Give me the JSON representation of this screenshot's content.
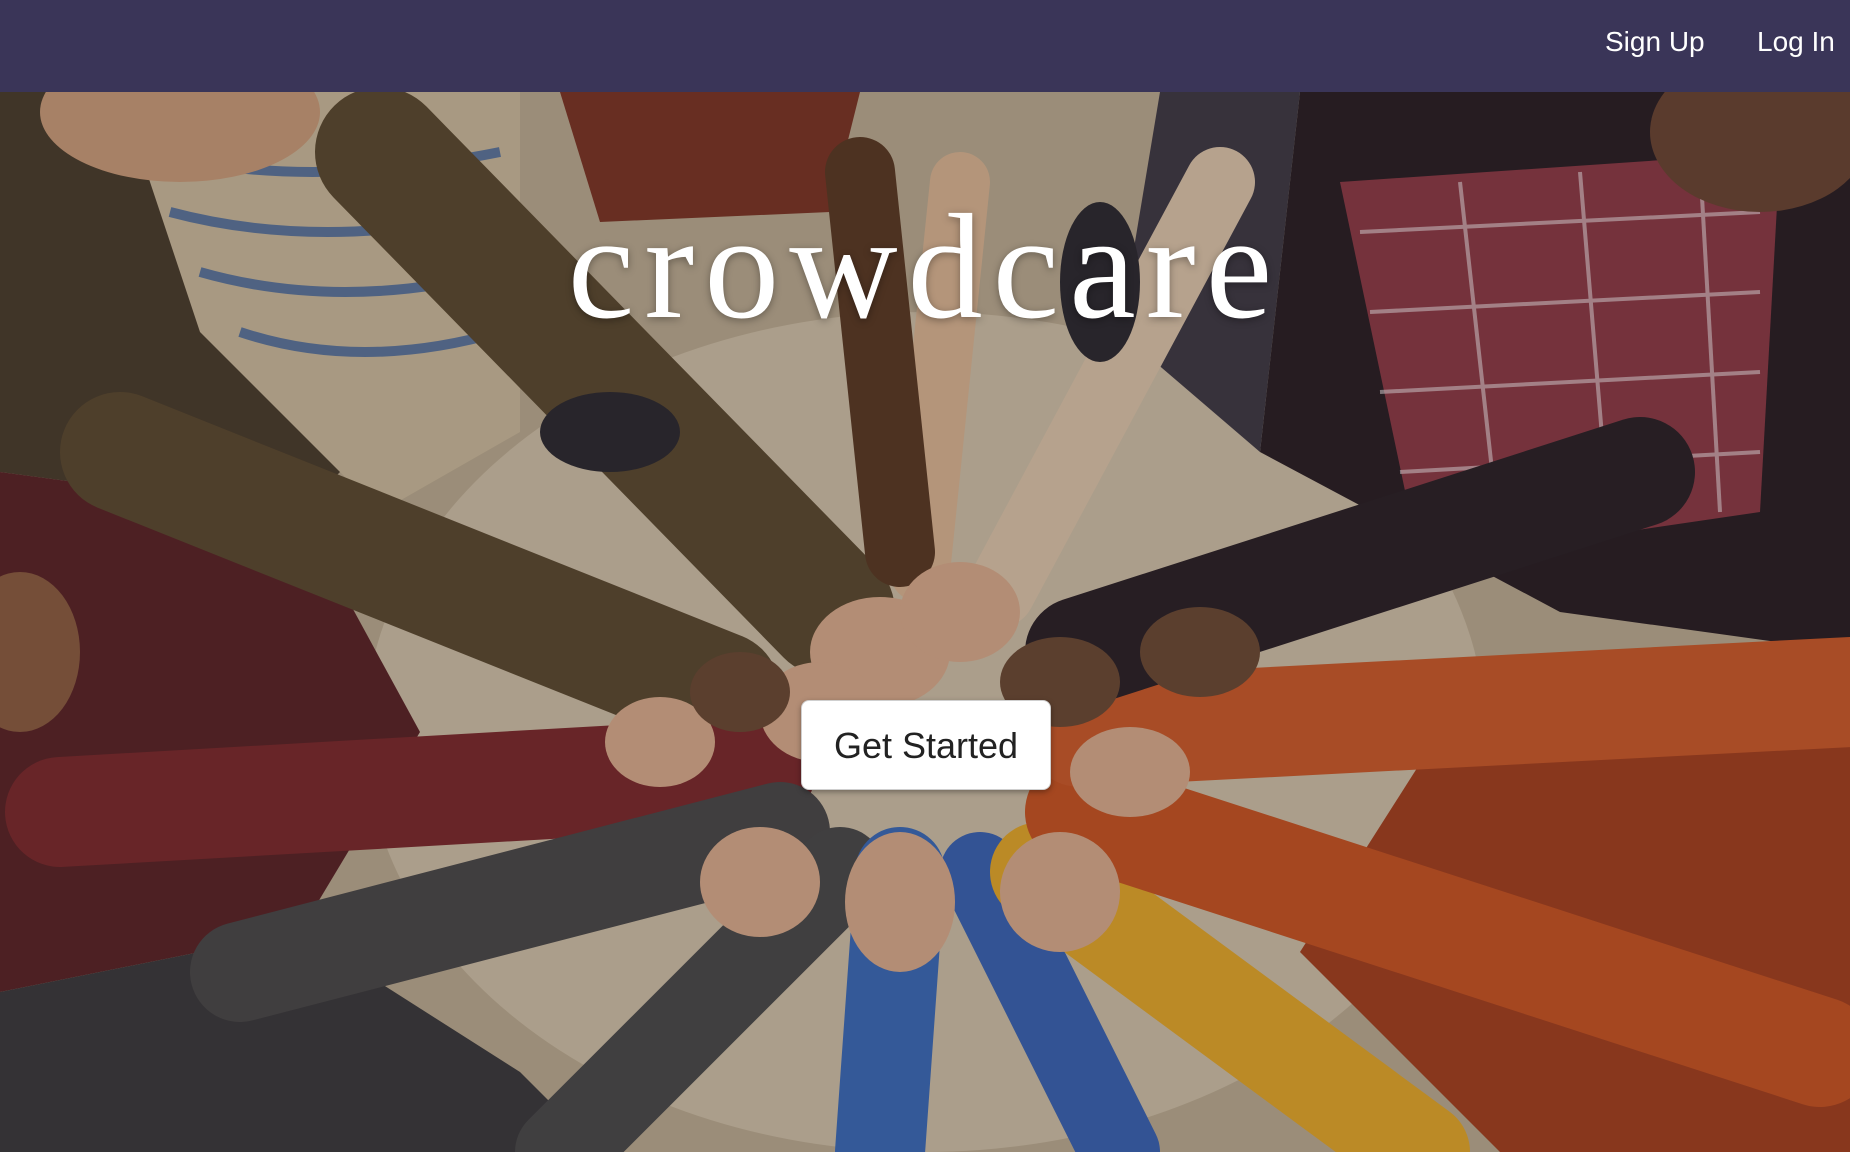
{
  "nav": {
    "signup_label": "Sign Up",
    "login_label": "Log In",
    "background_color": "#3a3558"
  },
  "hero": {
    "title": "crowdcare",
    "cta_label": "Get Started",
    "image_name": "hands-together-photo"
  }
}
